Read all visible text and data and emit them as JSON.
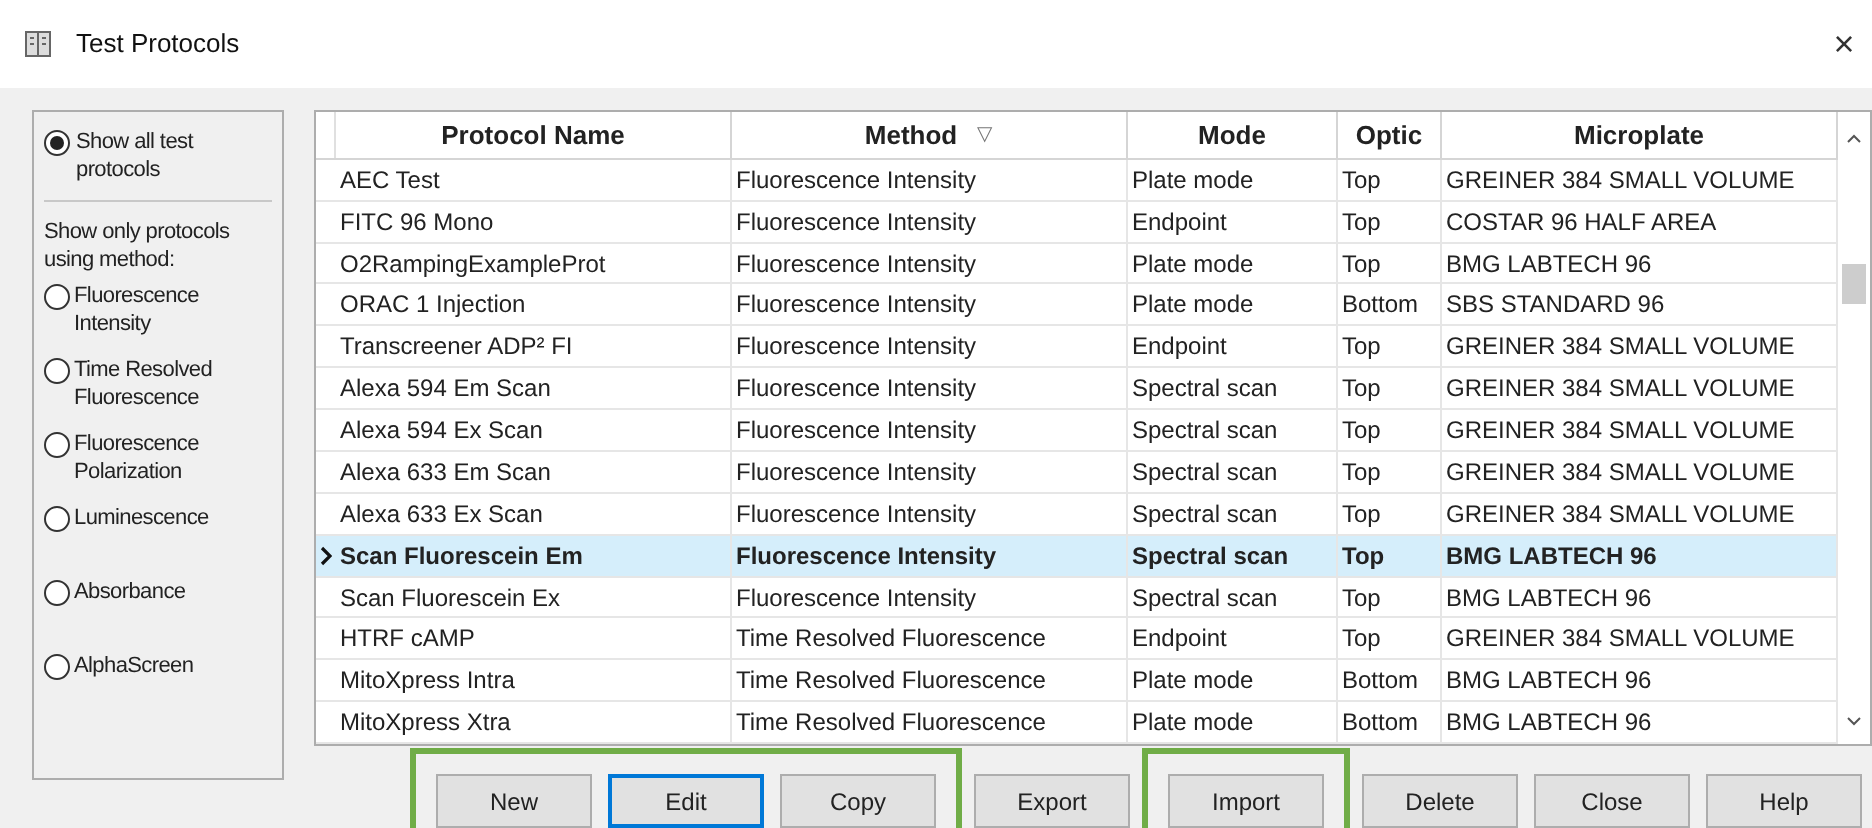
{
  "window": {
    "title": "Test Protocols",
    "close": "×"
  },
  "filter_panel": {
    "show_all": {
      "label": "Show all test protocols",
      "selected": true
    },
    "method_label": "Show only protocols using method:",
    "methods": [
      {
        "label": "Fluorescence Intensity",
        "selected": false
      },
      {
        "label": "Time Resolved Fluorescence",
        "selected": false
      },
      {
        "label": "Fluorescence Polarization",
        "selected": false
      },
      {
        "label": "Luminescence",
        "selected": false
      },
      {
        "label": "Absorbance",
        "selected": false
      },
      {
        "label": "AlphaScreen",
        "selected": false
      }
    ]
  },
  "table": {
    "columns": [
      {
        "label": "Protocol Name"
      },
      {
        "label": "Method",
        "sort": "▽"
      },
      {
        "label": "Mode"
      },
      {
        "label": "Optic"
      },
      {
        "label": "Microplate"
      }
    ],
    "rows": [
      {
        "cells": [
          "AEC Test",
          "Fluorescence Intensity",
          "Plate mode",
          "Top",
          "GREINER 384 SMALL VOLUME"
        ],
        "selected": false
      },
      {
        "cells": [
          "FITC 96 Mono",
          "Fluorescence Intensity",
          "Endpoint",
          "Top",
          "COSTAR 96 HALF AREA"
        ],
        "selected": false
      },
      {
        "cells": [
          "O2RampingExampleProt",
          "Fluorescence Intensity",
          "Plate mode",
          "Top",
          "BMG LABTECH 96"
        ],
        "selected": false
      },
      {
        "cells": [
          "ORAC 1 Injection",
          "Fluorescence Intensity",
          "Plate mode",
          "Bottom",
          "SBS STANDARD 96"
        ],
        "selected": false
      },
      {
        "cells": [
          "Transcreener ADP² FI",
          "Fluorescence Intensity",
          "Endpoint",
          "Top",
          "GREINER 384 SMALL VOLUME"
        ],
        "selected": false
      },
      {
        "cells": [
          "Alexa 594 Em Scan",
          "Fluorescence Intensity",
          "Spectral scan",
          "Top",
          "GREINER 384 SMALL VOLUME"
        ],
        "selected": false
      },
      {
        "cells": [
          "Alexa 594 Ex Scan",
          "Fluorescence Intensity",
          "Spectral scan",
          "Top",
          "GREINER 384 SMALL VOLUME"
        ],
        "selected": false
      },
      {
        "cells": [
          "Alexa 633 Em Scan",
          "Fluorescence Intensity",
          "Spectral scan",
          "Top",
          "GREINER 384 SMALL VOLUME"
        ],
        "selected": false
      },
      {
        "cells": [
          "Alexa 633 Ex Scan",
          "Fluorescence Intensity",
          "Spectral scan",
          "Top",
          "GREINER 384 SMALL VOLUME"
        ],
        "selected": false
      },
      {
        "cells": [
          "Scan Fluorescein Em",
          "Fluorescence Intensity",
          "Spectral scan",
          "Top",
          "BMG LABTECH 96"
        ],
        "selected": true
      },
      {
        "cells": [
          "Scan Fluorescein Ex",
          "Fluorescence Intensity",
          "Spectral scan",
          "Top",
          "BMG LABTECH 96"
        ],
        "selected": false
      },
      {
        "cells": [
          "HTRF cAMP",
          "Time Resolved Fluorescence",
          "Endpoint",
          "Top",
          "GREINER 384 SMALL VOLUME"
        ],
        "selected": false
      },
      {
        "cells": [
          "MitoXpress Intra",
          "Time Resolved Fluorescence",
          "Plate mode",
          "Bottom",
          "BMG LABTECH 96"
        ],
        "selected": false
      },
      {
        "cells": [
          "MitoXpress Xtra",
          "Time Resolved Fluorescence",
          "Plate mode",
          "Bottom",
          "BMG LABTECH 96"
        ],
        "selected": false
      }
    ]
  },
  "button_groups": [
    {
      "highlighted": true,
      "buttons": [
        {
          "label": "New",
          "focused": false
        },
        {
          "label": "Edit",
          "focused": true
        },
        {
          "label": "Copy",
          "focused": false
        }
      ]
    },
    {
      "highlighted": false,
      "buttons": [
        {
          "label": "Export",
          "focused": false
        }
      ]
    },
    {
      "highlighted": true,
      "buttons": [
        {
          "label": "Import",
          "focused": false
        }
      ]
    },
    {
      "highlighted": false,
      "buttons": [
        {
          "label": "Delete",
          "focused": false
        },
        {
          "label": "Close",
          "focused": false
        },
        {
          "label": "Help",
          "focused": false
        }
      ]
    }
  ]
}
